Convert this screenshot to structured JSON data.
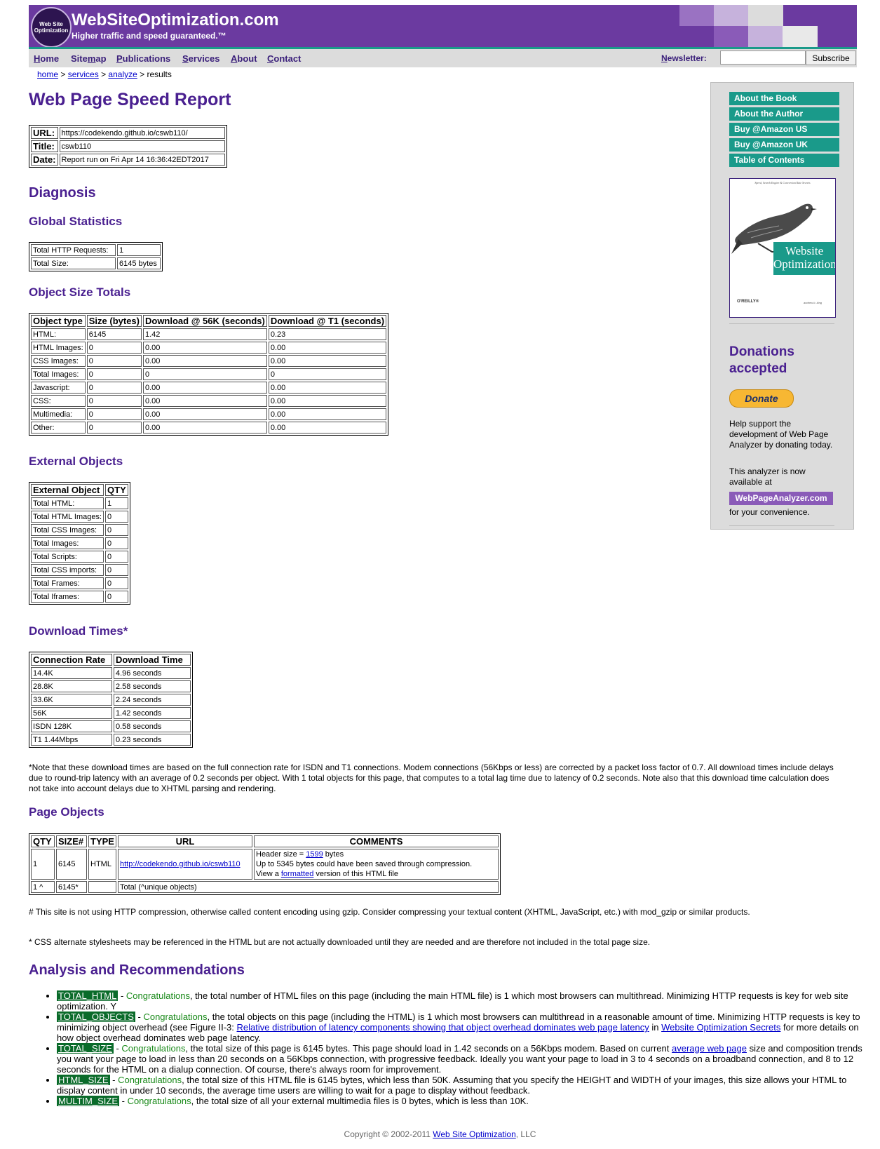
{
  "header": {
    "logo_text": "Web Site Optimization",
    "site_title": "WebSiteOptimization.com",
    "tagline": "Higher traffic and speed guaranteed.™"
  },
  "nav": {
    "items": [
      {
        "pre": "",
        "u": "H",
        "post": "ome"
      },
      {
        "pre": "Site",
        "u": "m",
        "post": "ap"
      },
      {
        "pre": "",
        "u": "P",
        "post": "ublications"
      },
      {
        "pre": "",
        "u": "S",
        "post": "ervices"
      },
      {
        "pre": "",
        "u": "A",
        "post": "bout"
      },
      {
        "pre": "",
        "u": "C",
        "post": "ontact"
      }
    ],
    "newsletter_u": "N",
    "newsletter_rest": "ewsletter:",
    "subscribe_label": "Subscribe"
  },
  "breadcrumb": {
    "home": "home",
    "services": "services",
    "analyze": "analyze",
    "current": "results",
    "sep": " > "
  },
  "report": {
    "title": "Web Page Speed Report",
    "url_label": "URL:",
    "url_value": "https://codekendo.github.io/cswb110/",
    "title_label": "Title:",
    "title_value": "cswb110",
    "date_label": "Date:",
    "date_value": "Report run on Fri Apr 14 16:36:42EDT2017"
  },
  "diagnosis": {
    "heading": "Diagnosis",
    "global_stats_heading": "Global Statistics",
    "global_stats": [
      [
        "Total HTTP Requests:",
        "1"
      ],
      [
        "Total Size:",
        "6145 bytes"
      ]
    ],
    "object_size_heading": "Object Size Totals",
    "object_size_headers": [
      "Object type",
      "Size (bytes)",
      "Download @ 56K (seconds)",
      "Download @ T1 (seconds)"
    ],
    "object_size_rows": [
      [
        "HTML:",
        "6145",
        "1.42",
        "0.23"
      ],
      [
        "HTML Images:",
        "0",
        "0.00",
        "0.00"
      ],
      [
        "CSS Images:",
        "0",
        "0.00",
        "0.00"
      ],
      [
        "Total Images:",
        "0",
        "0",
        "0"
      ],
      [
        "Javascript:",
        "0",
        "0.00",
        "0.00"
      ],
      [
        "CSS:",
        "0",
        "0.00",
        "0.00"
      ],
      [
        "Multimedia:",
        "0",
        "0.00",
        "0.00"
      ],
      [
        "Other:",
        "0",
        "0.00",
        "0.00"
      ]
    ],
    "external_heading": "External Objects",
    "external_headers": [
      "External Object",
      "QTY"
    ],
    "external_rows": [
      [
        "Total HTML:",
        "1"
      ],
      [
        "Total HTML Images:",
        "0"
      ],
      [
        "Total CSS Images:",
        "0"
      ],
      [
        "Total Images:",
        "0"
      ],
      [
        "Total Scripts:",
        "0"
      ],
      [
        "Total CSS imports:",
        "0"
      ],
      [
        "Total Frames:",
        "0"
      ],
      [
        "Total Iframes:",
        "0"
      ]
    ],
    "download_heading": "Download Times*",
    "download_headers": [
      "Connection Rate",
      "Download Time"
    ],
    "download_rows": [
      [
        "14.4K",
        "4.96 seconds"
      ],
      [
        "28.8K",
        "2.58 seconds"
      ],
      [
        "33.6K",
        "2.24 seconds"
      ],
      [
        "56K",
        "1.42 seconds"
      ],
      [
        "ISDN 128K",
        "0.58 seconds"
      ],
      [
        "T1 1.44Mbps",
        "0.23 seconds"
      ]
    ],
    "download_note": "*Note that these download times are based on the full connection rate for ISDN and T1 connections. Modem connections (56Kbps or less) are corrected by a packet loss factor of 0.7. All download times include delays due to round-trip latency with an average of 0.2 seconds per object. With 1 total objects for this page, that computes to a total lag time due to latency of 0.2 seconds. Note also that this download time calculation does not take into account delays due to XHTML parsing and rendering."
  },
  "page_objects": {
    "heading": "Page Objects",
    "headers": [
      "QTY",
      "SIZE#",
      "TYPE",
      "URL",
      "COMMENTS"
    ],
    "row": {
      "qty": "1",
      "size": "6145",
      "type": "HTML",
      "url": "http://codekendo.github.io/cswb110",
      "c1_pre": "Header size = ",
      "c1_link": "1599",
      "c1_post": " bytes",
      "c2": "Up to 5345 bytes could have been saved through compression.",
      "c3_pre": "View a ",
      "c3_link": "formatted",
      "c3_post": " version of this HTML file"
    },
    "total_row": {
      "qty": "1 ^",
      "size": "6145*",
      "type": "",
      "label": "Total (^unique objects)"
    },
    "note1": "# This site is not using HTTP compression, otherwise called content encoding using gzip. Consider compressing your textual content (XHTML, JavaScript, etc.) with mod_gzip or similar products.",
    "note2": "* CSS alternate stylesheets may be referenced in the HTML but are not actually downloaded until they are needed and are therefore not included in the total page size."
  },
  "analysis": {
    "heading": "Analysis and Recommendations",
    "sep": " - ",
    "items": [
      {
        "tag": "TOTAL_HTML",
        "status": "Congratulations",
        "text": ", the total number of HTML files on this page (including the main HTML file) is 1 which most browsers can multithread. Minimizing HTTP requests is key for web site optimization. Y"
      },
      {
        "tag": "TOTAL_OBJECTS",
        "status": "Congratulations",
        "text": ", the total objects on this page (including the HTML) is 1 which most browsers can multithread in a reasonable amount of time. Minimizing HTTP requests is key to minimizing object overhead (see Figure II-3: ",
        "link1": "Relative distribution of latency components showing that object overhead dominates web page latency",
        "mid": " in ",
        "link2": "Website Optimization Secrets",
        "tail": " for more details on how object overhead dominates web page latency."
      },
      {
        "tag": "TOTAL_SIZE",
        "status": "Congratulations",
        "text": ", the total size of this page is 6145 bytes. This page should load in 1.42 seconds on a 56Kbps modem. Based on current ",
        "link1": "average web page",
        "tail": " size and composition trends you want your page to load in less than 20 seconds on a 56Kbps connection, with progressive feedback. Ideally you want your page to load in 3 to 4 seconds on a broadband connection, and 8 to 12 seconds for the HTML on a dialup connection. Of course, there's always room for improvement."
      },
      {
        "tag": "HTML_SIZE",
        "status": "Congratulations",
        "text": ", the total size of this HTML file is 6145 bytes, which less than 50K. Assuming that you specify the HEIGHT and WIDTH of your images, this size allows your HTML to display content in under 10 seconds, the average time users are willing to wait for a page to display without feedback."
      },
      {
        "tag": "MULTIM_SIZE",
        "status": "Congratulations",
        "text": ", the total size of all your external multimedia files is 0 bytes, which is less than 10K."
      }
    ]
  },
  "sidebar": {
    "links": [
      "About the Book",
      "About the Author",
      "Buy @Amazon US",
      "Buy @Amazon UK",
      "Table of Contents"
    ],
    "book_subtitle": "Speed, Search Engine & Conversion Rate Secrets",
    "book_title_1": "Website",
    "book_title_2": "Optimization",
    "book_publisher": "O'REILLY®",
    "book_author": "andrew b. king",
    "donations_title": "Donations accepted",
    "donate_label": "Donate",
    "support_text": "Help support the development of Web Page Analyzer by donating today.",
    "available_text": "This analyzer is now available at",
    "analyzer_link": "WebPageAnalyzer.com",
    "convenience_text": "for your convenience."
  },
  "footer": {
    "pre": "Copyright © 2002-2011 ",
    "link": "Web Site Optimization",
    "post": ", LLC"
  },
  "colors": {
    "header_purple": "#6b3aa0",
    "heading_purple": "#4a2090",
    "accent_teal": "#1a9a8a",
    "status_green": "#1a8a1a",
    "tag_green": "#0a6b2a"
  }
}
